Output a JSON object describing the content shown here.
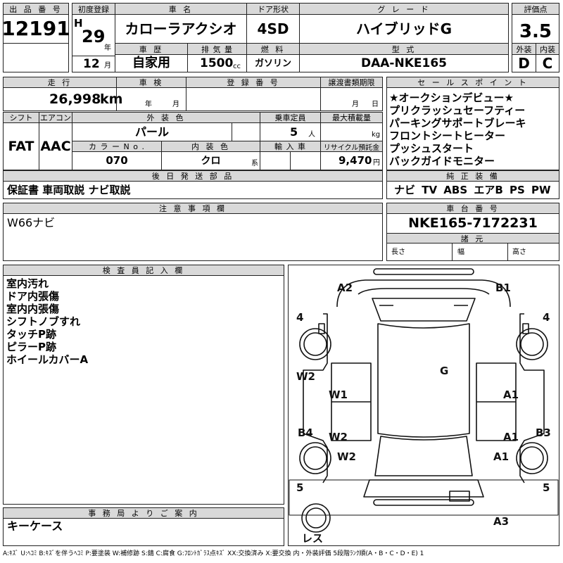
{
  "header": {
    "lot_label": "出 品 番 号",
    "lot_number": "12191",
    "first_reg_label": "初度登録",
    "era": "H",
    "year": "29",
    "year_unit": "年",
    "month": "12",
    "month_unit": "月",
    "model_label": "車 名",
    "model": "カローラアクシオ",
    "door_label": "ドア形状",
    "door": "4SD",
    "grade_label": "グ レ ー ド",
    "grade": "ハイブリッドG",
    "score_label": "評価点",
    "score": "3.5",
    "history_label": "車 歴",
    "history": "自家用",
    "displacement_label": "排 気 量",
    "displacement": "1500",
    "displacement_unit": "cc",
    "fuel_label": "燃 料",
    "fuel": "ガソリン",
    "type_label": "型 式",
    "type": "DAA-NKE165",
    "exterior_label": "外装",
    "exterior": "D",
    "interior_label": "内装",
    "interior": "C"
  },
  "details": {
    "mileage_label": "走 行",
    "mileage": "26,998",
    "mileage_unit": "km",
    "inspection_label": "車 検",
    "year_unit": "年",
    "month_unit": "月",
    "reg_label": "登 録 番 号",
    "doc_label": "譲渡書類期限",
    "doc_month_unit": "月",
    "doc_day_unit": "日",
    "shift_label": "シフト",
    "shift": "FAT",
    "ac_label": "エアコン",
    "ac": "AAC",
    "color_label": "外 装 色",
    "color": "パール",
    "capacity_label": "乗車定員",
    "capacity": "5",
    "capacity_unit": "人",
    "load_label": "最大積載量",
    "load_unit": "kg",
    "color_no_label": "カ ラ ー N o .",
    "color_no": "070",
    "int_color_label": "内 装 色",
    "int_color": "クロ",
    "int_color_unit": "系",
    "import_label": "輸 入 車",
    "recycle_label": "リサイクル預託金",
    "recycle": "9,470",
    "recycle_unit": "円",
    "later_label": "後 日 発 送 部 品",
    "later": "保証書 車両取説 ナビ取説"
  },
  "sales": {
    "label": "セ ー ル ス ポ イ ン ト",
    "points": [
      "★オークションデビュー★",
      "プリクラッシュセーフティー",
      "パーキングサポートブレーキ",
      "フロントシートヒーター",
      "プッシュスタート",
      "バックガイドモニター"
    ],
    "equipment_label": "純 正 装 備",
    "equipment": "ナビ TV ABS エアB PS PW"
  },
  "notes": {
    "label": "注 意 事 項 欄",
    "text": "W66ナビ"
  },
  "chassis": {
    "label": "車 台 番 号",
    "value": "NKE165-7172231",
    "dim_label": "諸 元",
    "length": "長さ",
    "width": "幅",
    "height": "高さ"
  },
  "inspector": {
    "label": "検 査 員 記 入 欄",
    "items": [
      "室内汚れ",
      "ドア内張傷",
      "室内内張傷",
      "シフトノブすれ",
      "タッチP跡",
      "ピラーP跡",
      "ホイールカバーA"
    ]
  },
  "office": {
    "label": "事 務 局 よ り ご 案 内",
    "text": "キーケース"
  },
  "diagram": {
    "marks": [
      "A2",
      "B1",
      "4",
      "4",
      "G",
      "W2",
      "W1",
      "A1",
      "W2",
      "A1",
      "B4",
      "B3",
      "W2",
      "A1",
      "5",
      "5",
      "A3",
      "レス"
    ]
  },
  "legend": "A:ｷｽﾞ U:ﾍｺﾐ B:ｷｽﾞを伴うﾍｺﾐ P:要塗装 W:補修跡 S:錆 C:腐食 G:ﾌﾛﾝﾄｶﾞﾗｽ点ｷｽﾞ XX:交換済み X:要交換 内・外装評価 5段階ﾗﾝｸ順(A・B・C・D・E) 1"
}
